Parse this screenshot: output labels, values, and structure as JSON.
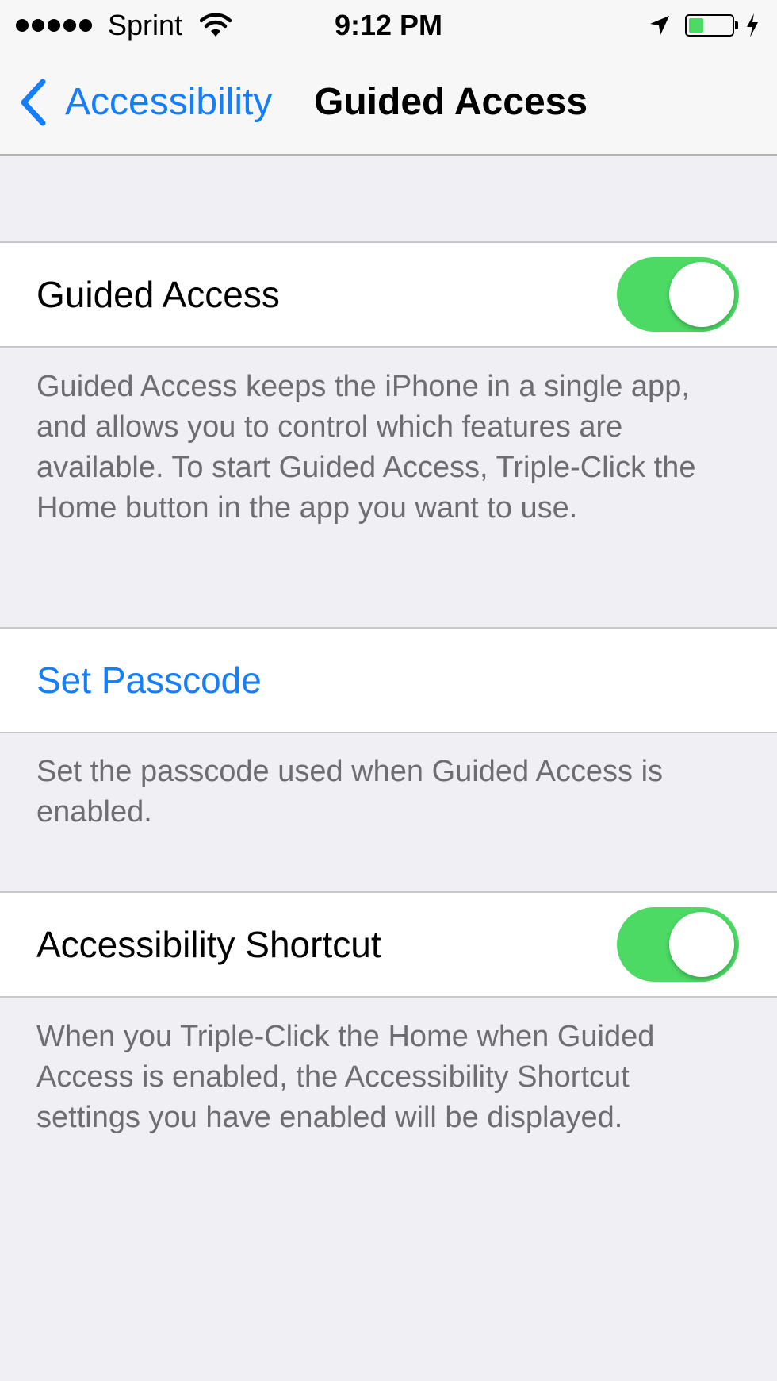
{
  "status_bar": {
    "carrier": "Sprint",
    "time": "9:12 PM",
    "battery_level": 0.35,
    "signal_bars": 5,
    "icons": [
      "wifi-icon",
      "location-arrow-icon",
      "battery-icon",
      "charging-bolt-icon"
    ]
  },
  "nav": {
    "back_label": "Accessibility",
    "title": "Guided Access"
  },
  "settings": {
    "guided_access": {
      "label": "Guided Access",
      "enabled": true,
      "footer": "Guided Access keeps the iPhone in a single app, and allows you to control which features are available. To start Guided Access, Triple-Click the Home button in the app you want to use."
    },
    "set_passcode": {
      "label": "Set Passcode",
      "footer": "Set the passcode used when Guided Access is enabled."
    },
    "accessibility_shortcut": {
      "label": "Accessibility Shortcut",
      "enabled": true,
      "footer": "When you Triple-Click the Home when Guided Access is enabled, the Accessibility Shortcut settings you have enabled will be displayed."
    }
  },
  "colors": {
    "accent": "#157efb",
    "toggle_on": "#4cd964",
    "background": "#efeff4",
    "footer_text": "#6d6d72"
  }
}
